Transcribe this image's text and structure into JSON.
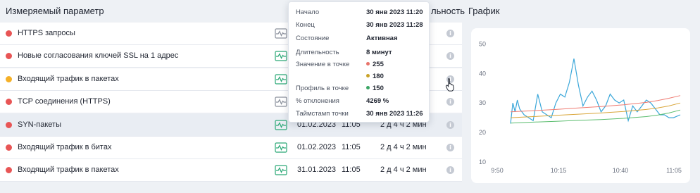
{
  "header": {
    "param_col": "Измеряемый параметр",
    "duration_col": "льность",
    "graph_col": "График"
  },
  "rows": [
    {
      "name": "HTTPS запросы",
      "status_color": "#e85555",
      "date": "",
      "time": "",
      "duration": "",
      "graph_icon_color": "#8a909c"
    },
    {
      "name": "Новые согласования ключей SSL на 1 адрес",
      "status_color": "#e85555",
      "date": "",
      "time": "",
      "duration": "",
      "graph_icon_color": "#2aa876"
    },
    {
      "name": "Входящий трафик в пакетах",
      "status_color": "#f5b027",
      "date": "",
      "time": "",
      "duration": "",
      "graph_icon_color": "#2aa876"
    },
    {
      "name": "TCP соединения (HTTPS)",
      "status_color": "#e85555",
      "date": "",
      "time": "",
      "duration": "",
      "graph_icon_color": "#8a909c"
    },
    {
      "name": "SYN-пакеты",
      "status_color": "#e85555",
      "date": "01.02.2023",
      "time": "11:05",
      "duration": "2 д 4 ч 2 мин",
      "graph_icon_color": "#2aa876"
    },
    {
      "name": "Входящий трафик в битах",
      "status_color": "#e85555",
      "date": "01.02.2023",
      "time": "11:05",
      "duration": "2 д 4 ч 2 мин",
      "graph_icon_color": "#2aa876"
    },
    {
      "name": "Входящий трафик в пакетах",
      "status_color": "#e85555",
      "date": "31.01.2023",
      "time": "11:05",
      "duration": "2 д 4 ч 2 мин",
      "graph_icon_color": "#2aa876"
    }
  ],
  "tooltip": {
    "start_label": "Начало",
    "start_value": "30 янв 2023 11:20",
    "end_label": "Конец",
    "end_value": "30 янв 2023 11:28",
    "state_label": "Состояние",
    "state_value": "Активная",
    "duration_label": "Длительность",
    "duration_value": "8 минут",
    "point_value_label": "Значение в точке",
    "point_value_1": "255",
    "point_value_1_color": "#e8736a",
    "point_value_2": "180",
    "point_value_2_color": "#c9a227",
    "profile_label": "Профиль в точке",
    "profile_value": "150",
    "profile_value_color": "#3aa564",
    "deviation_label": "% отклонения",
    "deviation_value": "4269 %",
    "timestamp_label": "Таймстамп точки",
    "timestamp_value": "30 янв 2023 11:26"
  },
  "chart_data": {
    "type": "line",
    "x_ticks": [
      "9:50",
      "10:15",
      "10:40",
      "11:05"
    ],
    "y_ticks": [
      "50",
      "40",
      "30",
      "20",
      "10"
    ],
    "ylim": [
      10,
      52
    ],
    "xlim": [
      0,
      75
    ],
    "series": [
      {
        "color": "#3ba7d9",
        "x": [
          0,
          1,
          2,
          3,
          4,
          6,
          8,
          10,
          12,
          14,
          16,
          18,
          20,
          22,
          24,
          26,
          28,
          30,
          32,
          34,
          36,
          38,
          40,
          42,
          44,
          46,
          48,
          50,
          52,
          54,
          56,
          58,
          60,
          62,
          64,
          66,
          68,
          70,
          72,
          75
        ],
        "y": [
          23,
          30,
          27,
          31,
          28,
          26,
          25,
          24,
          33,
          27,
          26,
          25,
          30,
          33,
          32,
          37,
          45,
          36,
          29,
          32,
          34,
          31,
          27,
          29,
          33,
          31,
          30,
          31,
          24,
          29,
          27,
          29,
          31,
          30,
          28,
          26,
          26,
          25,
          25,
          26
        ]
      },
      {
        "color": "#ef7b72",
        "x": [
          0,
          10,
          20,
          30,
          40,
          50,
          60,
          65,
          70,
          75
        ],
        "y": [
          27,
          27.4,
          27.8,
          28.3,
          28.8,
          29.4,
          30.2,
          30.8,
          31.6,
          32.5
        ]
      },
      {
        "color": "#d9a63a",
        "x": [
          0,
          10,
          20,
          30,
          40,
          50,
          60,
          65,
          70,
          75
        ],
        "y": [
          25,
          25.4,
          25.8,
          26.2,
          26.6,
          27.1,
          27.8,
          28.3,
          29,
          30
        ]
      },
      {
        "color": "#5bbd6e",
        "x": [
          0,
          10,
          20,
          30,
          40,
          50,
          60,
          65,
          70,
          75
        ],
        "y": [
          23.2,
          23.5,
          23.8,
          24.1,
          24.4,
          24.8,
          25.4,
          25.9,
          26.6,
          27.6
        ]
      }
    ]
  }
}
